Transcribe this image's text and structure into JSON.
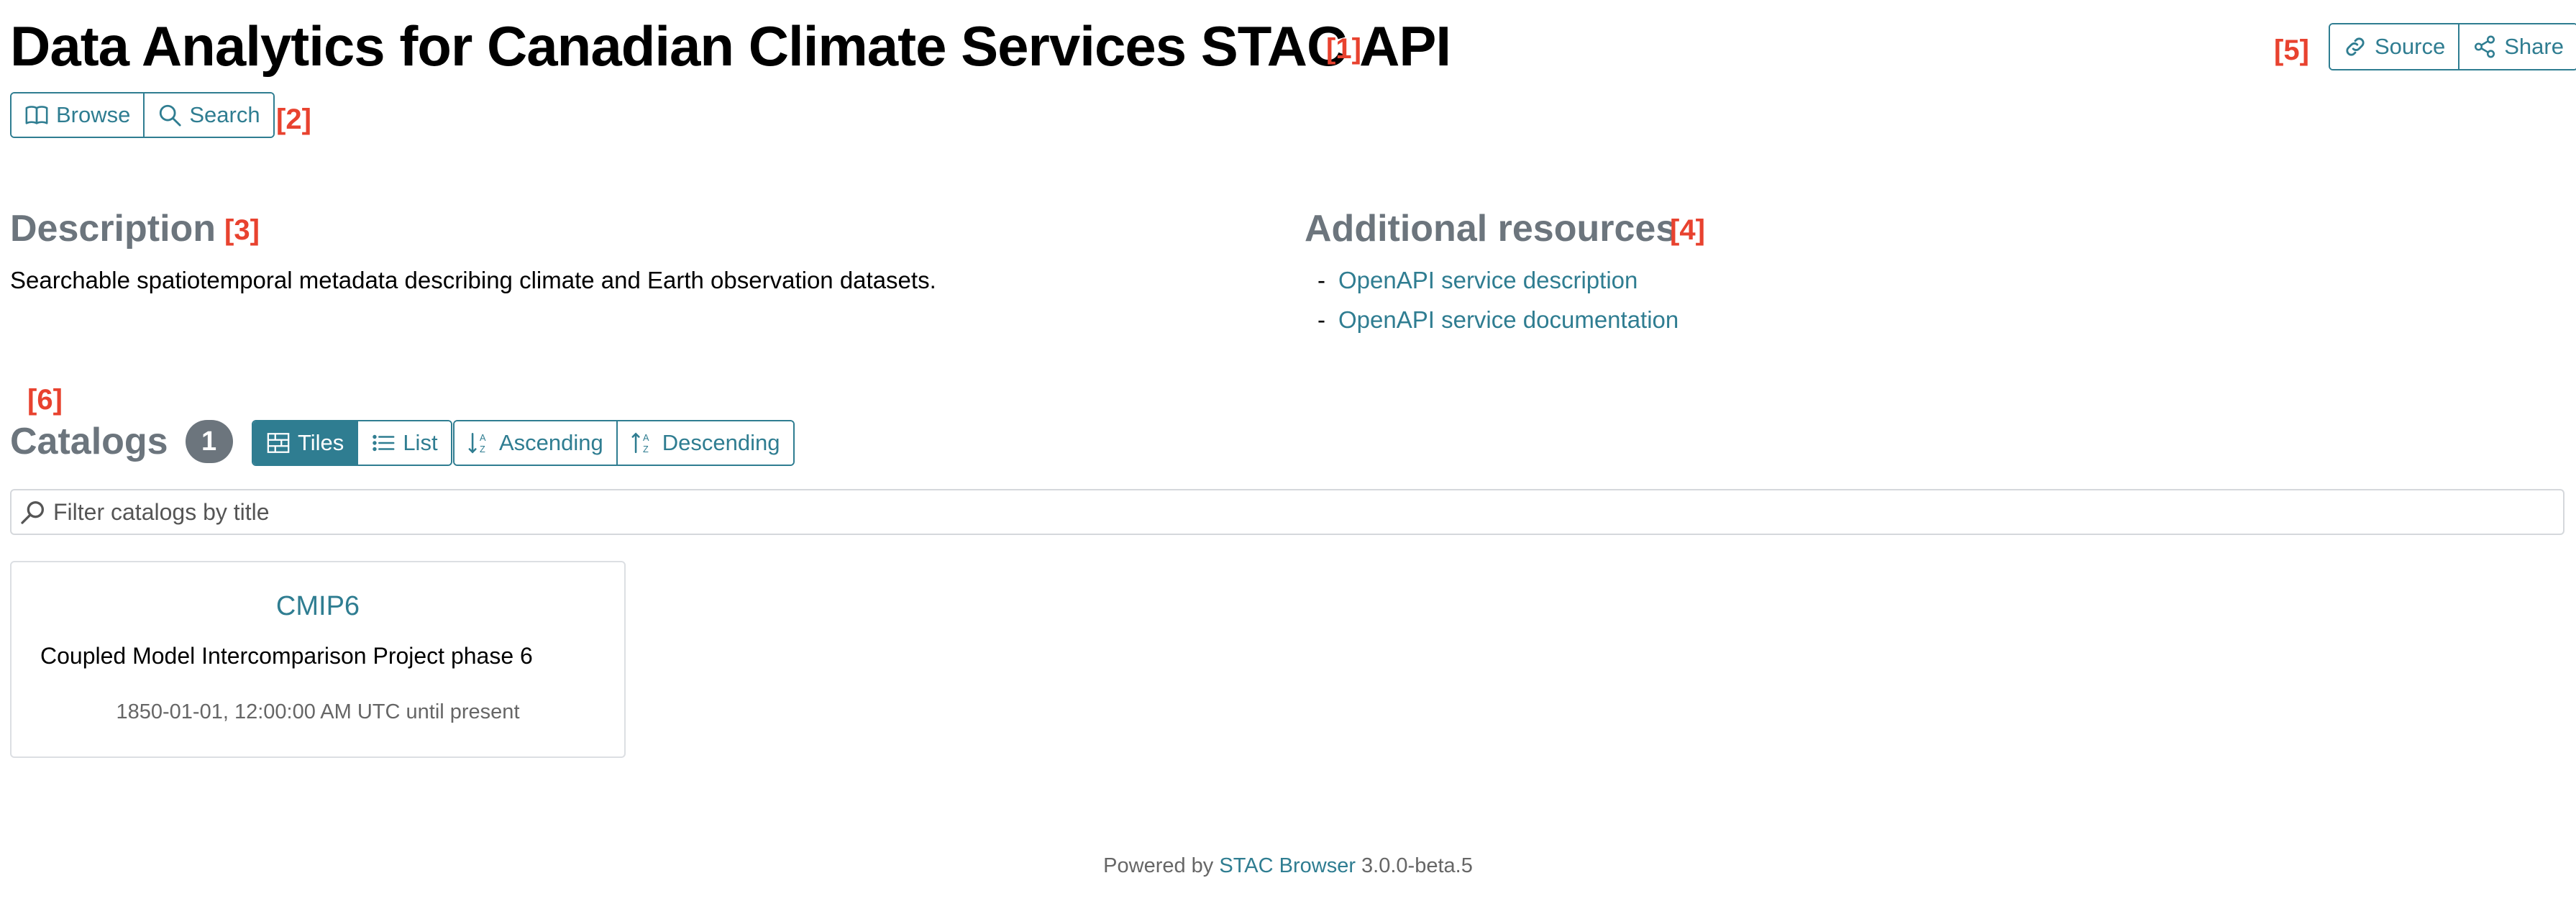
{
  "header": {
    "title": "Data Analytics for Canadian Climate Services STAC API",
    "ann_title": "[1]",
    "ann_nav": "[2]",
    "ann_actions": "[5]",
    "nav": {
      "browse_label": "Browse",
      "search_label": "Search"
    },
    "actions": {
      "source_label": "Source",
      "share_label": "Share"
    }
  },
  "description": {
    "heading": "Description",
    "ann": "[3]",
    "text": "Searchable spatiotemporal metadata describing climate and Earth observation datasets."
  },
  "resources": {
    "heading": "Additional resources",
    "ann": "[4]",
    "bullet": "-",
    "items": [
      {
        "label": "OpenAPI service description"
      },
      {
        "label": "OpenAPI service documentation"
      }
    ]
  },
  "catalogs": {
    "ann": "[6]",
    "heading": "Catalogs",
    "count": "1",
    "view": {
      "tiles_label": "Tiles",
      "list_label": "List",
      "active": "tiles"
    },
    "sort": {
      "ascending_label": "Ascending",
      "descending_label": "Descending"
    },
    "filter": {
      "placeholder": "Filter catalogs by title",
      "value": ""
    },
    "items": [
      {
        "title": "CMIP6",
        "description": "Coupled Model Intercomparison Project phase 6",
        "temporal": "1850-01-01, 12:00:00 AM UTC until present"
      }
    ]
  },
  "footer": {
    "prefix": "Powered by",
    "link": "STAC Browser",
    "version": "3.0.0-beta.5"
  },
  "colors": {
    "accent": "#2f7d91",
    "annotation": "#e8422f",
    "muted": "#6c757d"
  },
  "icons": {
    "browse": "book-icon",
    "search": "magnifier-icon",
    "source": "link-icon",
    "share": "share-icon",
    "tiles": "grid-icon",
    "list": "list-icon",
    "ascending": "sort-ascending-icon",
    "descending": "sort-descending-icon",
    "filter": "magnifier-icon"
  }
}
